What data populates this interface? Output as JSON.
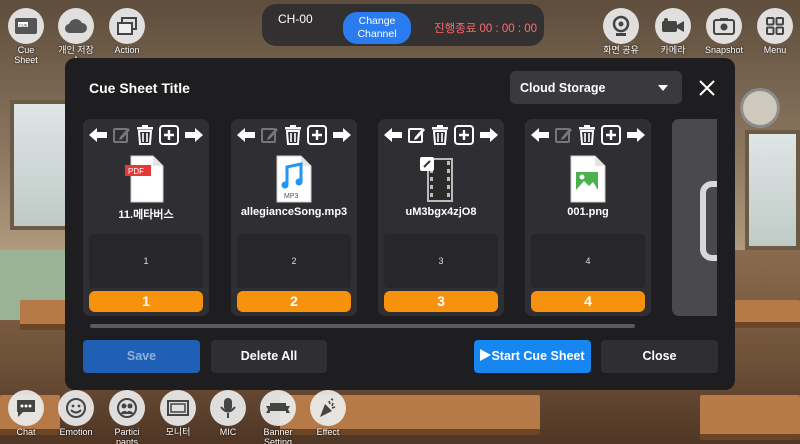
{
  "left_tools": [
    {
      "name": "cue-sheet-tool",
      "label": "Cue\nSheet",
      "icon": "cue-sheet-icon"
    },
    {
      "name": "personal-storage-tool",
      "label": "개인 저장소",
      "icon": "cloud-icon"
    },
    {
      "name": "action-tool",
      "label": "Action",
      "icon": "windows-icon"
    }
  ],
  "top_bar": {
    "channel": "CH-00",
    "change_channel": "Change\nChannel",
    "timer": "진행종료 00 : 00 : 00"
  },
  "right_tools": [
    {
      "name": "screen-share-tool",
      "label": "화면 공유",
      "icon": "webcam-icon"
    },
    {
      "name": "camera-tool",
      "label": "카메라",
      "icon": "video-camera-icon"
    },
    {
      "name": "snapshot-tool",
      "label": "Snapshot",
      "icon": "snapshot-icon"
    },
    {
      "name": "menu-tool",
      "label": "Menu",
      "icon": "grid-menu-icon"
    }
  ],
  "modal": {
    "title": "Cue Sheet Title",
    "storage_selected": "Cloud Storage",
    "cards": [
      {
        "file_name": "11.메타버스",
        "file_type": "pdf",
        "memo": "1",
        "number": "1",
        "edit_enabled": false
      },
      {
        "file_name": "allegianceSong.mp3",
        "file_type": "mp3",
        "memo": "2",
        "number": "2",
        "edit_enabled": false
      },
      {
        "file_name": "uM3bgx4zjO8",
        "file_type": "video",
        "memo": "3",
        "number": "3",
        "edit_enabled": true
      },
      {
        "file_name": "001.png",
        "file_type": "image",
        "memo": "4",
        "number": "4",
        "edit_enabled": false
      }
    ],
    "buttons": {
      "save": "Save",
      "delete_all": "Delete All",
      "start": "Start Cue Sheet",
      "close": "Close"
    }
  },
  "bottom_tools": [
    {
      "name": "chat-tool",
      "label": "Chat",
      "icon": "chat-bubble-icon"
    },
    {
      "name": "emotion-tool",
      "label": "Emotion",
      "icon": "smiley-icon"
    },
    {
      "name": "participants-tool",
      "label": "Partici\npants",
      "icon": "participants-icon"
    },
    {
      "name": "monitor-tool",
      "label": "모니터",
      "icon": "monitor-icon"
    },
    {
      "name": "mic-tool",
      "label": "MIC",
      "icon": "microphone-icon"
    },
    {
      "name": "banner-setting-tool",
      "label": "Banner\nSetting",
      "icon": "banner-icon"
    },
    {
      "name": "effect-tool",
      "label": "Effect",
      "icon": "party-popper-icon"
    }
  ],
  "colors": {
    "accent_blue": "#1786f0",
    "number_orange": "#f6920d",
    "timer_red": "#ff6b6b",
    "modal_bg": "#1e1e21"
  }
}
